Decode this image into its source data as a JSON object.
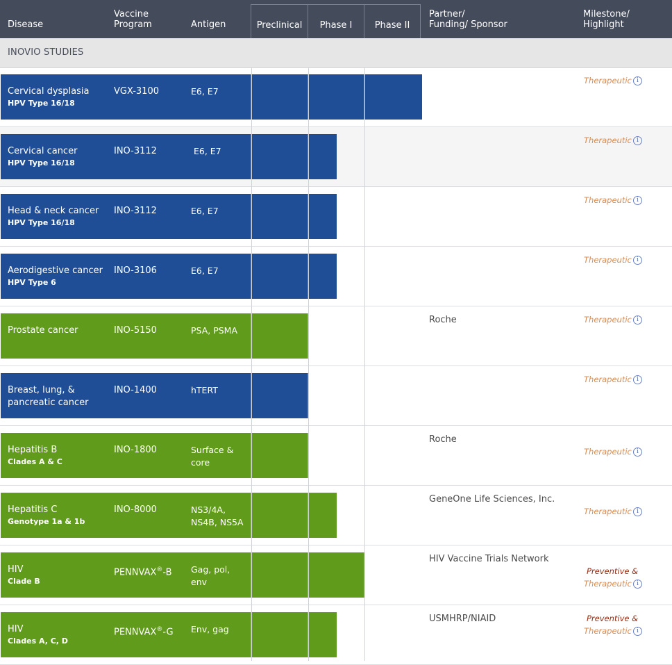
{
  "header": {
    "disease": "Disease",
    "vaccine_program": "Vaccine\nProgram",
    "antigen": "Antigen",
    "preclinical": "Preclinical",
    "phase1": "Phase I",
    "phase2": "Phase II",
    "partner": "Partner/\nFunding/ Sponsor",
    "milestone": "Milestone/\nHighlight"
  },
  "section_label": "INOVIO STUDIES",
  "colors": {
    "blue": "#1f4e96",
    "green": "#609b1c",
    "header_bg": "#444b5b"
  },
  "info_icon": "ⓘ",
  "rows": [
    {
      "disease": "Cervical dysplasia",
      "subtitle": "HPV Type 16/18",
      "program": "VGX-3100",
      "program_mark": "",
      "program_suffix": "",
      "antigen": "E6, E7",
      "color": "blue",
      "stage": "Phase II",
      "partner": "",
      "milestone_pre": "",
      "milestone": "Therapeutic"
    },
    {
      "disease": "Cervical cancer",
      "subtitle": "HPV Type 16/18",
      "program": "INO-3112",
      "program_mark": "",
      "program_suffix": "",
      "antigen": " E6, E7",
      "color": "blue",
      "stage": "Phase I",
      "partner": "",
      "milestone_pre": "",
      "milestone": "Therapeutic"
    },
    {
      "disease": "Head & neck cancer",
      "subtitle": "HPV Type 16/18",
      "program": "INO-3112",
      "program_mark": "",
      "program_suffix": "",
      "antigen": "E6, E7",
      "color": "blue",
      "stage": "Phase I",
      "partner": "",
      "milestone_pre": "",
      "milestone": "Therapeutic"
    },
    {
      "disease": "Aerodigestive cancer",
      "subtitle": "HPV Type 6",
      "program": "INO-3106",
      "program_mark": "",
      "program_suffix": "",
      "antigen": "E6, E7",
      "color": "blue",
      "stage": "Phase I",
      "partner": "",
      "milestone_pre": "",
      "milestone": "Therapeutic"
    },
    {
      "disease": "Prostate cancer",
      "subtitle": "",
      "program": "INO-5150",
      "program_mark": "",
      "program_suffix": "",
      "antigen": "PSA, PSMA",
      "color": "green",
      "stage": "Preclinical",
      "partner": "Roche",
      "milestone_pre": "",
      "milestone": "Therapeutic"
    },
    {
      "disease": "Breast, lung, &\npancreatic cancer",
      "subtitle": "",
      "program": "INO-1400",
      "program_mark": "",
      "program_suffix": "",
      "antigen": "hTERT",
      "color": "blue",
      "stage": "Preclinical",
      "partner": "",
      "milestone_pre": "",
      "milestone": "Therapeutic"
    },
    {
      "disease": "Hepatitis B",
      "subtitle": "Clades A & C",
      "program": "INO-1800",
      "program_mark": "",
      "program_suffix": "",
      "antigen": "Surface &\ncore",
      "color": "green",
      "stage": "Preclinical",
      "partner": "Roche",
      "milestone_pre": "",
      "milestone": "Therapeutic"
    },
    {
      "disease": "Hepatitis C",
      "subtitle": "Genotype 1a & 1b",
      "program": "INO-8000",
      "program_mark": "",
      "program_suffix": "",
      "antigen": "NS3/4A,\nNS4B, NS5A",
      "color": "green",
      "stage": "Phase I",
      "partner": "GeneOne Life Sciences, Inc.",
      "milestone_pre": "",
      "milestone": "Therapeutic"
    },
    {
      "disease": "HIV",
      "subtitle": "Clade B",
      "program": "PENNVAX",
      "program_mark": "®",
      "program_suffix": "-B",
      "antigen": "Gag, pol,\nenv",
      "color": "green",
      "stage": "Phase II (partial)",
      "partner": "HIV Vaccine Trials Network",
      "milestone_pre": "Preventive &",
      "milestone": "Therapeutic"
    },
    {
      "disease": "HIV",
      "subtitle": "Clades A, C, D",
      "program": "PENNVAX",
      "program_mark": "®",
      "program_suffix": "-G",
      "antigen": "Env, gag",
      "color": "green",
      "stage": "Phase I",
      "partner": "USMHRP/NIAID",
      "milestone_pre": "Preventive &",
      "milestone": "Therapeutic"
    }
  ]
}
